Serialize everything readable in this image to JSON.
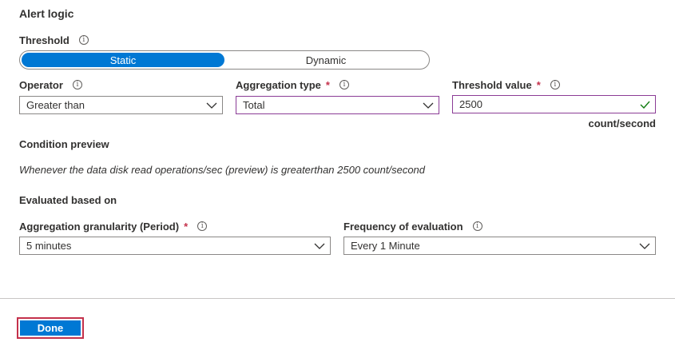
{
  "alert_logic": {
    "title": "Alert logic",
    "threshold": {
      "label": "Threshold",
      "options": [
        "Static",
        "Dynamic"
      ],
      "selected": "Static"
    },
    "operator": {
      "label": "Operator",
      "value": "Greater than"
    },
    "aggregation_type": {
      "label": "Aggregation type",
      "required": "*",
      "value": "Total"
    },
    "threshold_value": {
      "label": "Threshold value",
      "required": "*",
      "value": "2500",
      "unit": "count/second"
    }
  },
  "condition_preview": {
    "title": "Condition preview",
    "text": "Whenever the data disk read operations/sec (preview) is greaterthan 2500 count/second"
  },
  "evaluated": {
    "title": "Evaluated based on",
    "granularity": {
      "label": "Aggregation granularity (Period)",
      "required": "*",
      "value": "5 minutes"
    },
    "frequency": {
      "label": "Frequency of evaluation",
      "value": "Every 1 Minute"
    }
  },
  "footer": {
    "done_label": "Done"
  },
  "colors": {
    "accent": "#0078d4",
    "required": "#c4314b",
    "focus_border": "#8b3c96",
    "valid_check": "#107c10"
  }
}
